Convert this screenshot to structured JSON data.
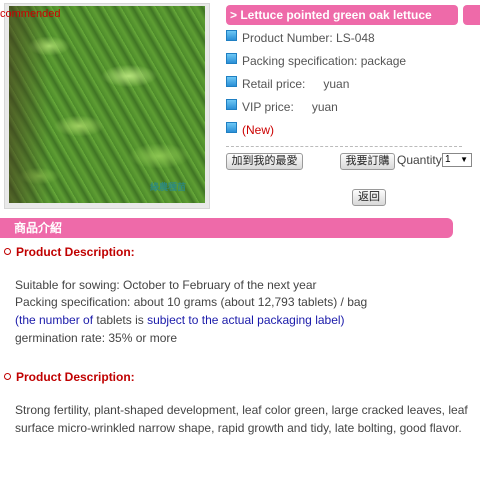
{
  "product": {
    "recommended_tag": "commended",
    "watermark": "綠農種苗",
    "title": "> Lettuce pointed green oak lettuce",
    "number_label": "Product Number: LS-048",
    "packing_label": "Packing specification: package",
    "retail_label": "Retail price:",
    "retail_value": "yuan",
    "vip_label": "VIP price:",
    "vip_value": "yuan",
    "new_label": "(New)"
  },
  "actions": {
    "favorite_button": "加到我的最愛",
    "order_button": "我要訂購",
    "quantity_label": "Quantity",
    "quantity_value": "1",
    "back_button": "返回"
  },
  "section": {
    "title": "商品介紹"
  },
  "description1": {
    "heading": "Product Description:",
    "line1": "Suitable for sowing: October to February of the next year",
    "line2": "Packing specification: about 10 grams (about 12,793 tablets) / bag",
    "line3_part1": "(the number of ",
    "line3_part2": "tablets is ",
    "line3_part3": "subject to the actual packaging label)",
    "line4": "germination rate: 35% or more"
  },
  "description2": {
    "heading": "Product Description:",
    "line1": "Strong fertility, plant-shaped development, leaf color green, large cracked leaves, leaf",
    "line2": "surface micro-wrinkled narrow shape, rapid growth and tidy, late bolting, good flavor."
  },
  "colors": {
    "accent_pink": "#ee6aa9",
    "heading_red": "#c00000",
    "link_blue": "#1a1aaa"
  }
}
